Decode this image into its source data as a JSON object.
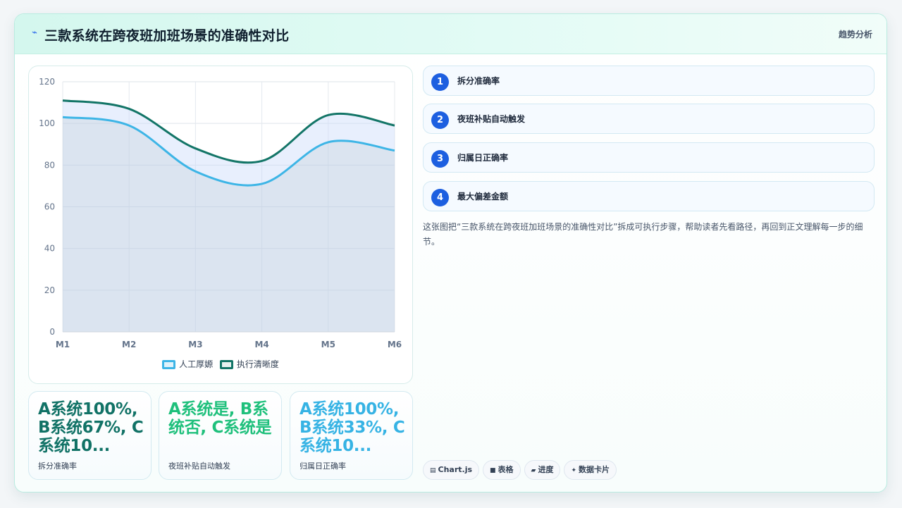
{
  "header": {
    "icon": "trend-icon",
    "title": "三款系统在跨夜班加班场景的准确性对比",
    "action_label": "趋势分析"
  },
  "chart_data": {
    "type": "area",
    "categories": [
      "M1",
      "M2",
      "M3",
      "M4",
      "M5",
      "M6"
    ],
    "ylim": [
      0,
      120
    ],
    "yticks": [
      0,
      20,
      40,
      60,
      80,
      100,
      120
    ],
    "grid": true,
    "legend_position": "bottom",
    "series": [
      {
        "name": "人工厚嫄",
        "values": [
          103,
          99,
          77,
          71,
          91,
          87
        ],
        "color": "#3db5e6"
      },
      {
        "name": "执行清晰度",
        "values": [
          111,
          107,
          88,
          82,
          104,
          99
        ],
        "color": "#137567"
      }
    ]
  },
  "stats": [
    {
      "value": "A系统100%, B系统67%, C系统10...",
      "label": "拆分准确率",
      "color": "#117266"
    },
    {
      "value": "A系统是, B系统否, C系统是",
      "label": "夜班补贴自动触发",
      "color": "#1fc07c"
    },
    {
      "value": "A系统100%, B系统33%, C系统10...",
      "label": "归属日正确率",
      "color": "#36b3e4"
    }
  ],
  "steps": [
    {
      "num": "1",
      "label": "拆分准确率"
    },
    {
      "num": "2",
      "label": "夜班补贴自动触发"
    },
    {
      "num": "3",
      "label": "归属日正确率"
    },
    {
      "num": "4",
      "label": "最大偏差金额"
    }
  ],
  "description": "这张图把“三款系统在跨夜班加班场景的准确性对比”拆成可执行步骤，帮助读者先看路径，再回到正文理解每一步的细节。",
  "tags": [
    {
      "icon": "chart-icon",
      "glyph": "▤",
      "label": "Chart.js"
    },
    {
      "icon": "table-icon",
      "glyph": "■",
      "label": "表格"
    },
    {
      "icon": "progress-icon",
      "glyph": "▰",
      "label": "进度"
    },
    {
      "icon": "sparkle-icon",
      "glyph": "✦",
      "label": "数据卡片"
    }
  ]
}
